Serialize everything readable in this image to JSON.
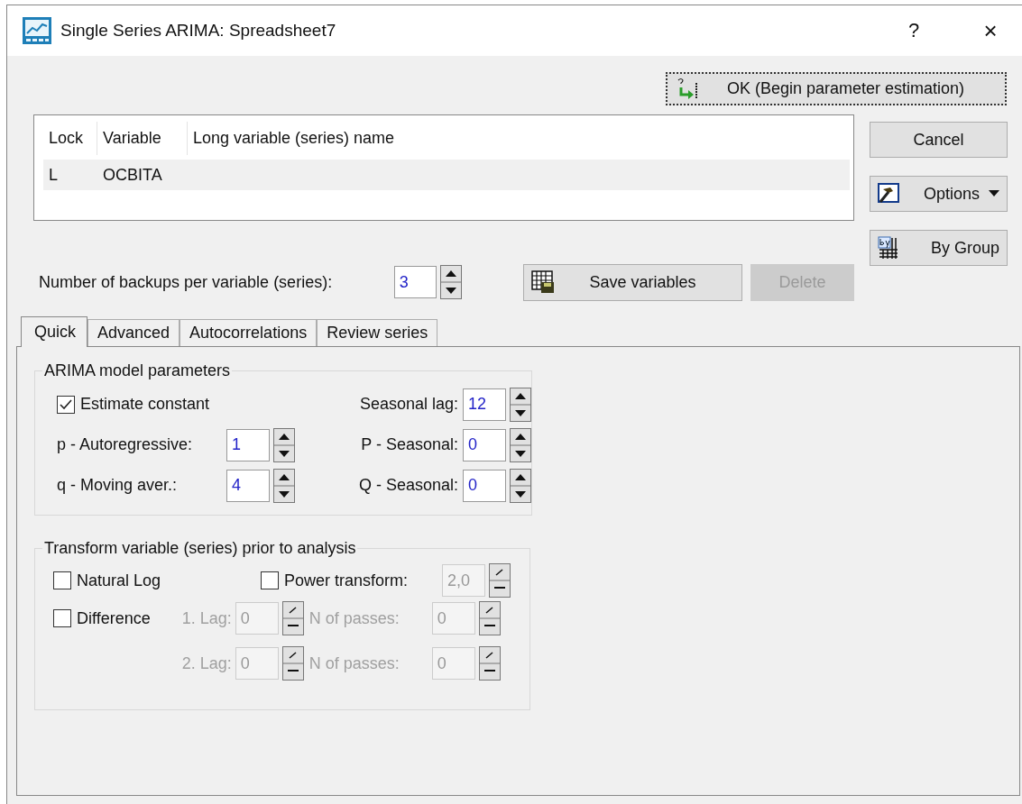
{
  "window": {
    "title": "Single Series ARIMA: Spreadsheet7",
    "help": "?",
    "close": "×"
  },
  "ok_button": "OK (Begin parameter estimation)",
  "side_buttons": [
    {
      "kind": "cancel",
      "label": "Cancel"
    },
    {
      "kind": "options",
      "label": "Options"
    },
    {
      "kind": "bygroup",
      "label": "By Group"
    }
  ],
  "variables_table": {
    "columns": [
      "Lock",
      "Variable",
      "Long variable (series) name"
    ],
    "rows": [
      {
        "lock": "L",
        "variable": "OCBITA",
        "selected": true
      }
    ]
  },
  "backups": {
    "label": "Number of backups per variable (series):",
    "value": "3"
  },
  "save_button": "Save variables",
  "delete_button": {
    "label": "Delete",
    "disabled": true
  },
  "tabs": [
    {
      "label": "Quick",
      "selected": true
    },
    {
      "label": "Advanced",
      "selected": false
    },
    {
      "label": "Autocorrelations",
      "selected": false
    },
    {
      "label": "Review series",
      "selected": false
    }
  ],
  "arima": {
    "title": "ARIMA model parameters",
    "estimate_constant": {
      "label": "Estimate constant",
      "checked": true
    },
    "left_fields": [
      {
        "label": "p - Autoregressive:",
        "value": "1"
      },
      {
        "label": "q - Moving aver.:",
        "value": "4"
      }
    ],
    "right_fields": [
      {
        "label": "Seasonal lag:",
        "value": "12"
      },
      {
        "label": "P - Seasonal:",
        "value": "0"
      },
      {
        "label": "Q - Seasonal:",
        "value": "0"
      }
    ]
  },
  "transform": {
    "title": "Transform variable (series) prior to analysis",
    "natural_log": {
      "label": "Natural Log",
      "checked": false
    },
    "power_transform": {
      "label": "Power transform:",
      "checked": false,
      "value": "2,0",
      "disabled": true
    },
    "difference": {
      "label": "Difference",
      "checked": false
    },
    "lags": [
      {
        "lag_label": "1. Lag:",
        "lag": "0",
        "passes_label": "N of passes:",
        "passes": "0",
        "disabled": true
      },
      {
        "lag_label": "2. Lag:",
        "lag": "0",
        "passes_label": "N of passes:",
        "passes": "0",
        "disabled": true
      }
    ]
  }
}
